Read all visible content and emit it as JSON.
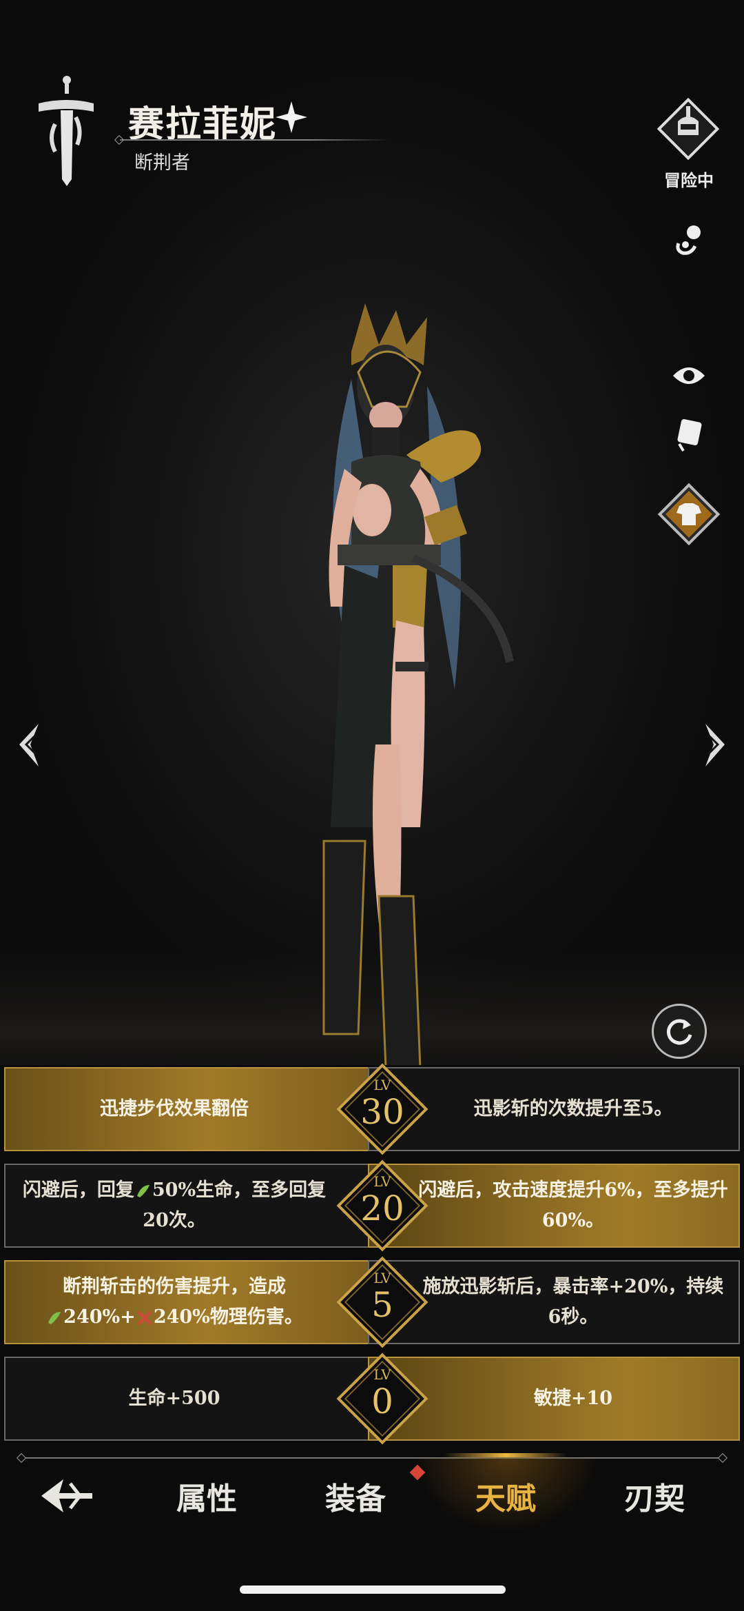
{
  "header": {
    "character_name": "赛拉菲妮",
    "character_class": "断荆者"
  },
  "side_buttons": {
    "adventure_label": "冒险中"
  },
  "talents": [
    {
      "level_label": "LV",
      "level": "30",
      "left": "迅捷步伐效果翻倍",
      "right": "迅影斩的次数提升至5。"
    },
    {
      "level_label": "LV",
      "level": "20",
      "left_pre": "闪避后，回复",
      "left_post": "50%生命，至多回复20次。",
      "right": "闪避后，攻击速度提升6%，至多提升60%。"
    },
    {
      "level_label": "LV",
      "level": "5",
      "left_pre": "断荆斩击的伤害提升，造成",
      "left_mid": "240%+",
      "left_post": "240%物理伤害。",
      "right": "施放迅影斩后，暴击率+20%，持续6秒。"
    },
    {
      "level_label": "LV",
      "level": "0",
      "left": "生命+500",
      "right": "敏捷+10"
    }
  ],
  "tabs": {
    "attributes": "属性",
    "equipment": "装备",
    "talent": "天赋",
    "pact": "刃契"
  },
  "colors": {
    "gold_accent": "#e8b340",
    "notification": "#d9443a"
  }
}
